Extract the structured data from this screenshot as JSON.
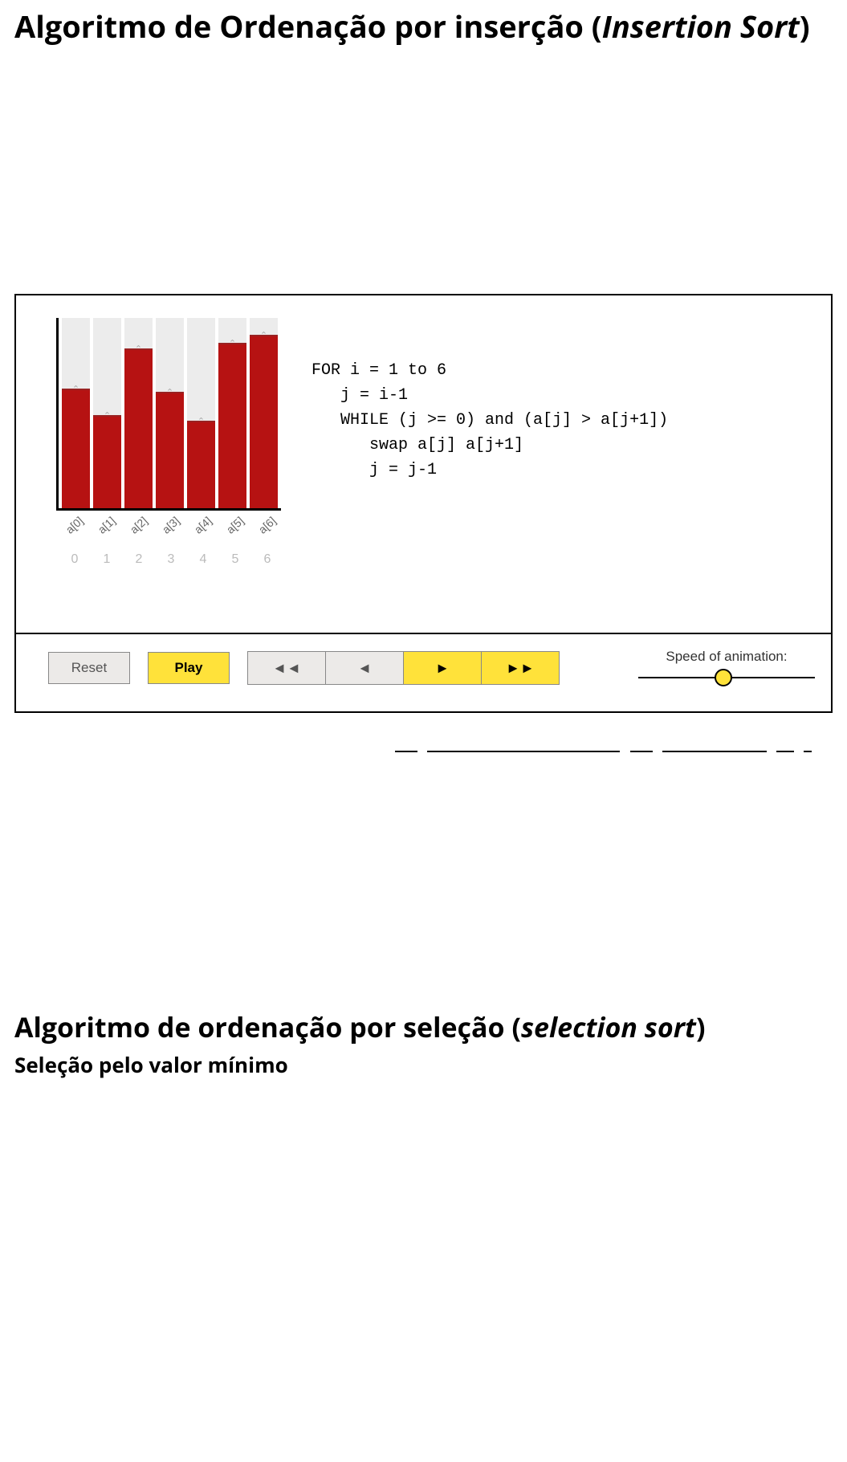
{
  "heading1_plain": "Algoritmo de Ordenação por inserção (",
  "heading1_ital": "Insertion Sort",
  "heading1_close": ")",
  "chart_data": {
    "type": "bar",
    "categories": [
      "a[0]",
      "a[1]",
      "a[2]",
      "a[3]",
      "a[4]",
      "a[5]",
      "a[6]"
    ],
    "indices": [
      "0",
      "1",
      "2",
      "3",
      "4",
      "5",
      "6"
    ],
    "values": [
      62,
      48,
      83,
      60,
      45,
      86,
      90
    ],
    "ylim": [
      0,
      100
    ],
    "title": "",
    "xlabel": "",
    "ylabel": ""
  },
  "pseudo_lines": {
    "l1": "FOR i = 1 to 6",
    "l2": "   j = i-1",
    "l3": "   WHILE (j >= 0) and (a[j] > a[j+1])",
    "l4": "      swap a[j] a[j+1]",
    "l5": "      j = j-1"
  },
  "controls": {
    "reset": "Reset",
    "play": "Play",
    "step_back_fast": "◄◄",
    "step_back": "◄",
    "step_fwd": "►",
    "step_fwd_fast": "►►",
    "speed_label": "Speed of animation:",
    "speed_value_percent": 48
  },
  "heading2_plain": "Algoritmo de ordenação por seleção (",
  "heading2_ital": "selection sort",
  "heading2_close": ")",
  "subheading2": "Seleção pelo valor mínimo"
}
